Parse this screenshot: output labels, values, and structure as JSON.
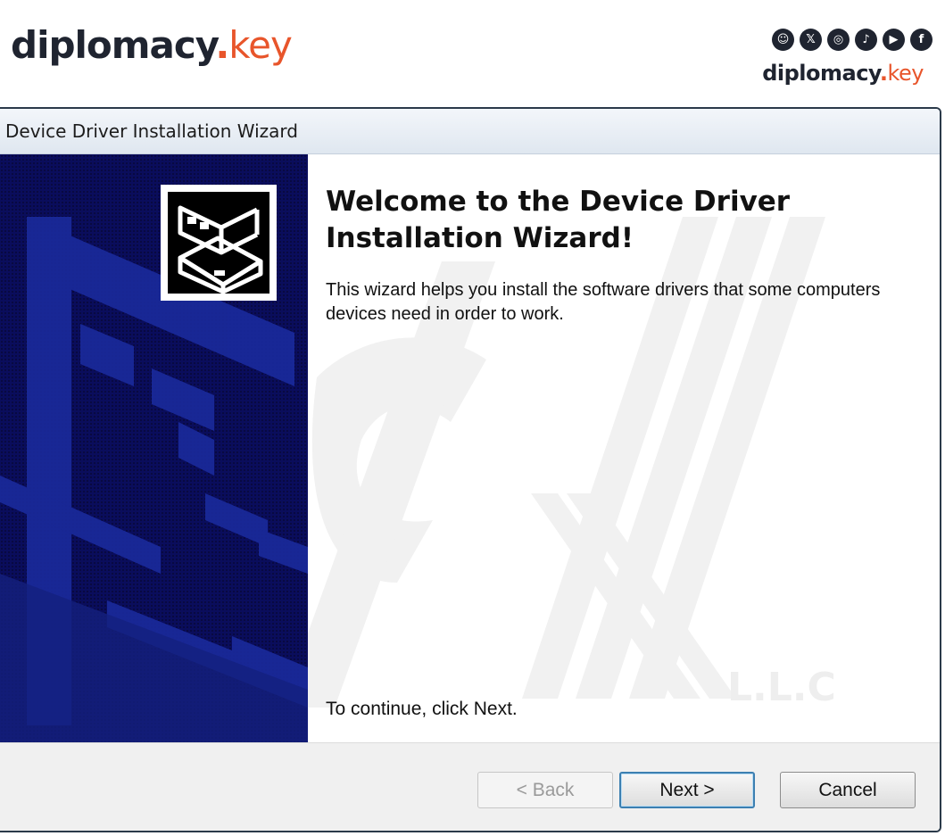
{
  "branding": {
    "logo_left": {
      "part1": "diplomacy",
      "dot": ".",
      "part2": "key"
    },
    "logo_right": {
      "part1": "diplomacy",
      "dot": ".",
      "part2": "key"
    },
    "social_icons": [
      "snapchat-icon",
      "x-icon",
      "instagram-icon",
      "tiktok-icon",
      "youtube-icon",
      "facebook-icon"
    ],
    "social_glyphs": [
      "☺",
      "𝕏",
      "◎",
      "♪",
      "▶",
      "f"
    ],
    "accent_color": "#e8552b"
  },
  "window": {
    "title": "Device Driver Installation Wizard",
    "heading_line1": "Welcome to the Device Driver",
    "heading_line2": "Installation Wizard!",
    "description": "This wizard helps you install the software drivers that some computers devices need in order to work.",
    "continue_text": "To continue, click Next.",
    "watermark_text": "L.L.C",
    "side_panel_color": "#0a0d5c"
  },
  "buttons": {
    "back": "< Back",
    "next": "Next >",
    "cancel": "Cancel"
  }
}
